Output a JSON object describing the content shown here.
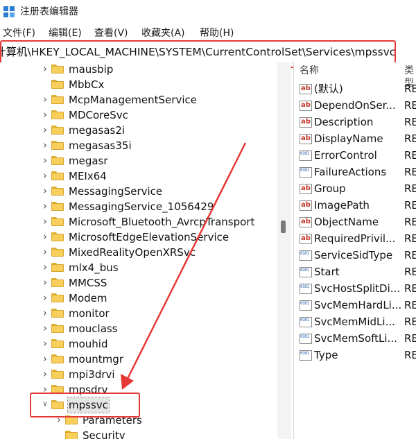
{
  "window": {
    "title": "注册表编辑器"
  },
  "menu": [
    "文件(F)",
    "编辑(E)",
    "查看(V)",
    "收藏夹(A)",
    "帮助(H)"
  ],
  "address": {
    "path": "计算机\\HKEY_LOCAL_MACHINE\\SYSTEM\\CurrentControlSet\\Services\\mpssvc"
  },
  "tree": {
    "items": [
      {
        "label": "mausbip",
        "expander": true
      },
      {
        "label": "MbbCx",
        "expander": false
      },
      {
        "label": "McpManagementService",
        "expander": true
      },
      {
        "label": "MDCoreSvc",
        "expander": true
      },
      {
        "label": "megasas2i",
        "expander": true
      },
      {
        "label": "megasas35i",
        "expander": true
      },
      {
        "label": "megasr",
        "expander": true
      },
      {
        "label": "MEIx64",
        "expander": true
      },
      {
        "label": "MessagingService",
        "expander": true
      },
      {
        "label": "MessagingService_1056429",
        "expander": true
      },
      {
        "label": "Microsoft_Bluetooth_AvrcpTransport",
        "expander": true
      },
      {
        "label": "MicrosoftEdgeElevationService",
        "expander": true
      },
      {
        "label": "MixedRealityOpenXRSvc",
        "expander": true
      },
      {
        "label": "mlx4_bus",
        "expander": true
      },
      {
        "label": "MMCSS",
        "expander": true
      },
      {
        "label": "Modem",
        "expander": true
      },
      {
        "label": "monitor",
        "expander": true
      },
      {
        "label": "mouclass",
        "expander": true
      },
      {
        "label": "mouhid",
        "expander": true
      },
      {
        "label": "mountmgr",
        "expander": true
      },
      {
        "label": "mpi3drvi",
        "expander": true
      },
      {
        "label": "mpsdrv",
        "expander": true
      },
      {
        "label": "mpssvc",
        "expander": "open",
        "selected": true
      },
      {
        "label": "Parameters",
        "expander": true,
        "child": true
      },
      {
        "label": "Security",
        "expander": false,
        "child": true
      }
    ]
  },
  "values": {
    "headers": {
      "name": "名称",
      "type": "类型"
    },
    "rows": [
      {
        "name": "(默认)",
        "icon": "string-value-icon",
        "type": "RE"
      },
      {
        "name": "DependOnSer...",
        "icon": "string-value-icon",
        "type": "RE"
      },
      {
        "name": "Description",
        "icon": "string-value-icon",
        "type": "RE"
      },
      {
        "name": "DisplayName",
        "icon": "string-value-icon",
        "type": "RE"
      },
      {
        "name": "ErrorControl",
        "icon": "binary-value-icon",
        "type": "RE"
      },
      {
        "name": "FailureActions",
        "icon": "binary-value-icon",
        "type": "RE"
      },
      {
        "name": "Group",
        "icon": "string-value-icon",
        "type": "RE"
      },
      {
        "name": "ImagePath",
        "icon": "string-value-icon",
        "type": "RE"
      },
      {
        "name": "ObjectName",
        "icon": "string-value-icon",
        "type": "RE"
      },
      {
        "name": "RequiredPrivil...",
        "icon": "string-value-icon",
        "type": "RE"
      },
      {
        "name": "ServiceSidType",
        "icon": "binary-value-icon",
        "type": "RE"
      },
      {
        "name": "Start",
        "icon": "binary-value-icon",
        "type": "RE"
      },
      {
        "name": "SvcHostSplitDi...",
        "icon": "binary-value-icon",
        "type": "RE"
      },
      {
        "name": "SvcMemHardLi...",
        "icon": "binary-value-icon",
        "type": "RE"
      },
      {
        "name": "SvcMemMidLi...",
        "icon": "binary-value-icon",
        "type": "RE"
      },
      {
        "name": "SvcMemSoftLi...",
        "icon": "binary-value-icon",
        "type": "RE"
      },
      {
        "name": "Type",
        "icon": "binary-value-icon",
        "type": "RE"
      }
    ]
  },
  "colors": {
    "annotation": "#e53935",
    "folder": "#f7cf5a",
    "selection": "#e5e5e5"
  }
}
